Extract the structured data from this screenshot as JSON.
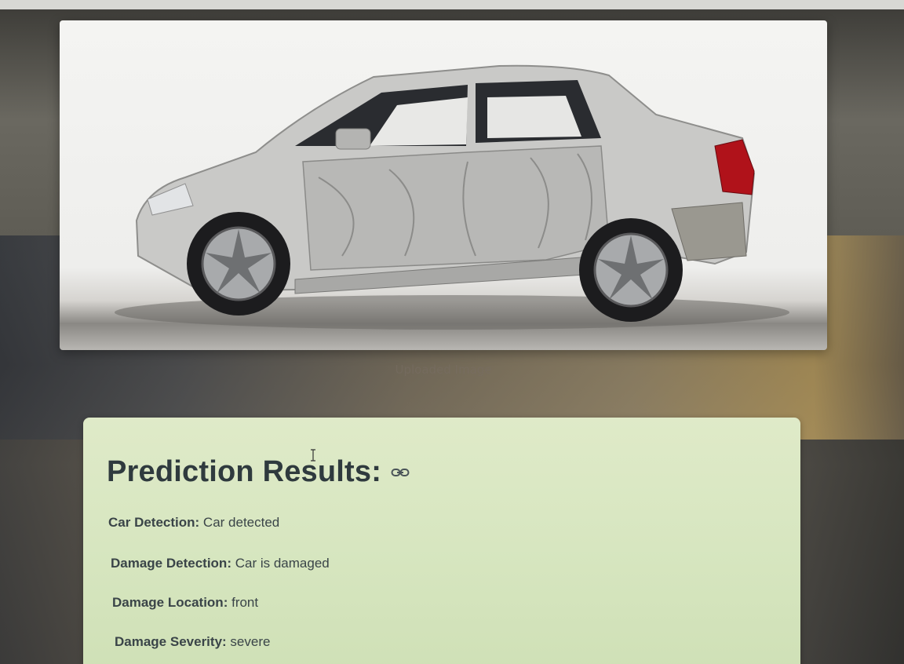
{
  "uploaded_image": {
    "caption": "Uploaded Image",
    "alt": "damaged silver sedan side view"
  },
  "results": {
    "title": "Prediction Results:",
    "link_icon": "link-icon",
    "rows": [
      {
        "label": "Car Detection:",
        "value": "Car detected"
      },
      {
        "label": "Damage Detection:",
        "value": "Car is damaged"
      },
      {
        "label": "Damage Location:",
        "value": "front"
      },
      {
        "label": "Damage Severity:",
        "value": "severe"
      }
    ]
  },
  "colors": {
    "results_bg": "#d7e6c0",
    "title_text": "#2f3a3e"
  }
}
